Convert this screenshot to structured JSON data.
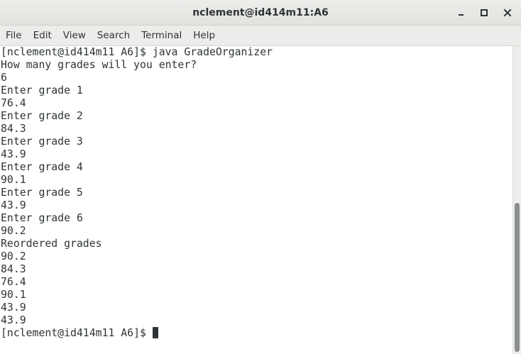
{
  "window": {
    "title": "nclement@id414m11:A6",
    "controls": [
      "minimize-icon",
      "maximize-icon",
      "close-icon"
    ]
  },
  "menubar": {
    "items": [
      {
        "label": "File"
      },
      {
        "label": "Edit"
      },
      {
        "label": "View"
      },
      {
        "label": "Search"
      },
      {
        "label": "Terminal"
      },
      {
        "label": "Help"
      }
    ]
  },
  "terminal": {
    "lines": [
      "[nclement@id414m11 A6]$ java GradeOrganizer",
      "How many grades will you enter?",
      "6",
      "Enter grade 1",
      "76.4",
      "Enter grade 2",
      "84.3",
      "Enter grade 3",
      "43.9",
      "Enter grade 4",
      "90.1",
      "Enter grade 5",
      "43.9",
      "Enter grade 6",
      "90.2",
      "Reordered grades",
      "90.2",
      "84.3",
      "76.4",
      "90.1",
      "43.9",
      "43.9"
    ],
    "prompt": "[nclement@id414m11 A6]$ "
  },
  "colors": {
    "text": "#2e3436",
    "background": "#ffffff",
    "titlebar": "#e6e6e3",
    "scroll_thumb": "#8a8e8f"
  }
}
